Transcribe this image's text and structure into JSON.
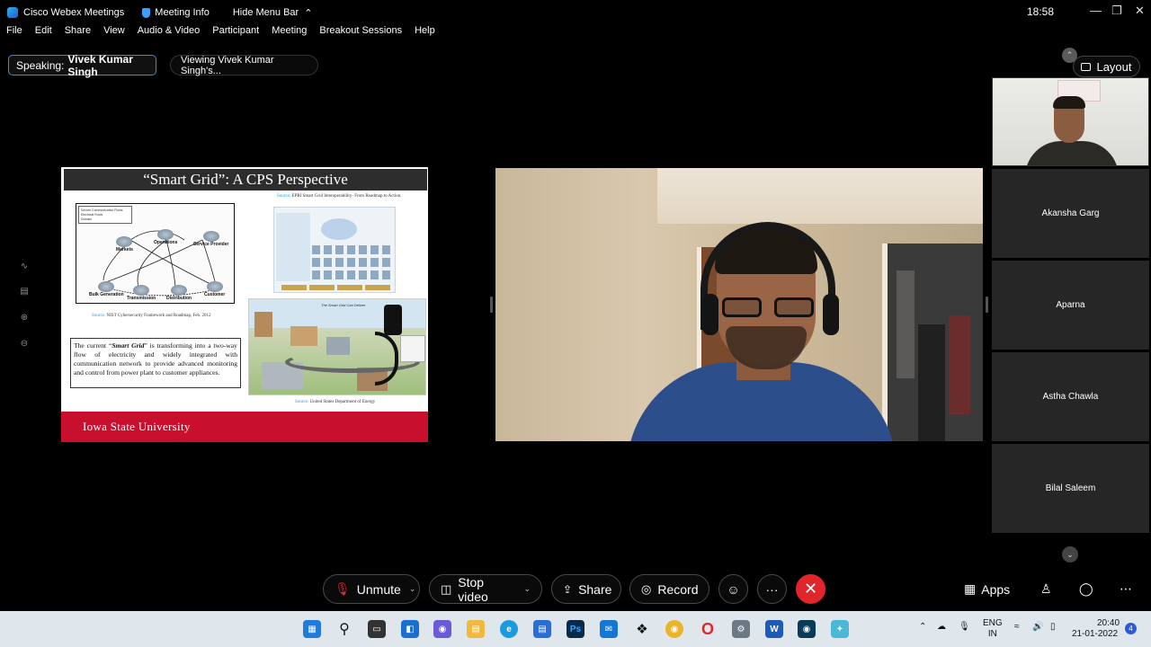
{
  "titlebar": {
    "app_title": "Cisco Webex Meetings",
    "meeting_info": "Meeting Info",
    "hide_menu": "Hide Menu Bar",
    "clock": "18:58"
  },
  "menu": [
    "File",
    "Edit",
    "Share",
    "View",
    "Audio & Video",
    "Participant",
    "Meeting",
    "Breakout Sessions",
    "Help"
  ],
  "status": {
    "speaking_label": "Speaking:",
    "speaking_name": "Vivek Kumar Singh",
    "viewing": "Viewing Vivek Kumar Singh's..."
  },
  "layout_label": "Layout",
  "slide": {
    "title": "“Smart Grid”: A CPS Perspective",
    "source_top_label": "Source:",
    "source_top": "EPRI Smart Grid Interoperability- From Roadmap to Action.",
    "source_nist_label": "Source:",
    "source_nist": "NIST Cybersecurity Framework and Roadmap, Feb. 2012",
    "source_doe_label": "Source:",
    "source_doe": "United States Department of Energy",
    "legend": [
      "Secure Communication Flows",
      "Electrical Flows",
      "Domain"
    ],
    "nodes": {
      "markets": "Markets",
      "operations": "Operations",
      "service_provider": "Service Provider",
      "bulk_generation": "Bulk Generation",
      "transmission": "Transmission",
      "distribution": "Distribution",
      "customer": "Customer"
    },
    "grid_image_title": "The Smart Grid Can Deliver",
    "body_pre": "The current “",
    "body_em": "Smart Grid",
    "body_post": "” is transforming into a two-way flow of electricity and widely integrated with communication network to provide advanced monitoring and control from power plant to customer appliances.",
    "footer": "Iowa State University"
  },
  "participants": [
    {
      "name": "Akansha Garg"
    },
    {
      "name": "Aparna"
    },
    {
      "name": "Astha Chawla"
    },
    {
      "name": "Bilal Saleem"
    }
  ],
  "controls": {
    "unmute": "Unmute",
    "stop_video": "Stop video",
    "share": "Share",
    "record": "Record",
    "more": "···",
    "apps": "Apps"
  },
  "taskbar": {
    "lang_top": "ENG",
    "lang_bottom": "IN",
    "time": "20:40",
    "date": "21-01-2022",
    "notifications": "4"
  },
  "colors": {
    "accent_blue": "#3a8dde",
    "leave_red": "#e0262b",
    "slide_footer_red": "#c8102e"
  }
}
